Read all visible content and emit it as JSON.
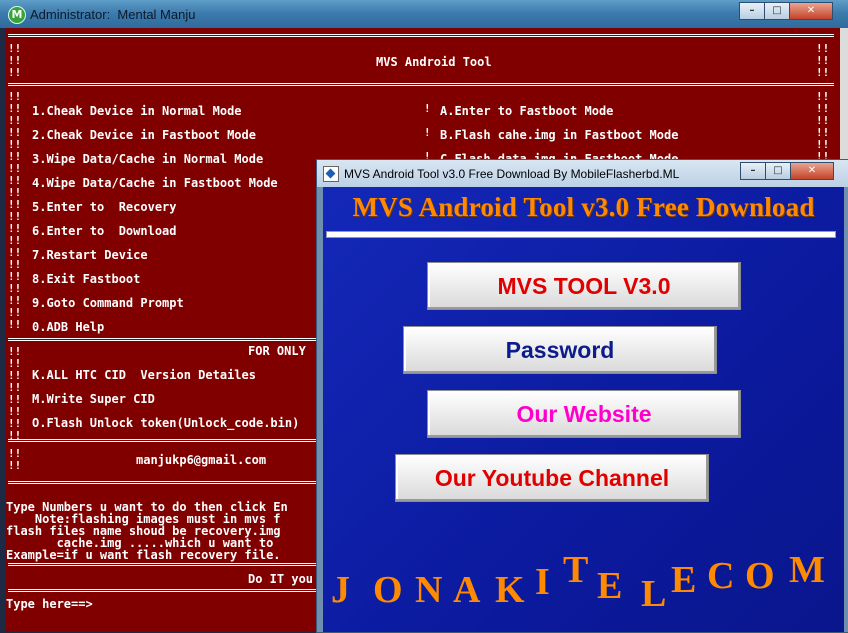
{
  "console": {
    "title": "Administrator:  Mental Manju",
    "app_initial": "M",
    "minimize": "–",
    "maximize": "□",
    "close": "✕",
    "heading": "MVS Android Tool",
    "left_menu": [
      "1.Cheak Device in Normal Mode",
      "2.Cheak Device in Fastboot Mode",
      "3.Wipe Data/Cache in Normal Mode",
      "4.Wipe Data/Cache in Fastboot Mode",
      "5.Enter to  Recovery",
      "6.Enter to  Download",
      "7.Restart Device",
      "8.Exit Fastboot",
      "9.Goto Command Prompt",
      "0.ADB Help"
    ],
    "right_menu": [
      "A.Enter to Fastboot Mode",
      "B.Flash cahe.img in Fastboot Mode",
      "C.Flash data.img in Fastboot Mode"
    ],
    "for_only": "FOR ONLY",
    "htc_menu": [
      "K.ALL HTC CID  Version Detailes",
      "M.Write Super CID",
      "O.Flash Unlock token(Unlock_code.bin)"
    ],
    "email": "manjukp6@gmail.com",
    "notes": [
      "Type Numbers u want to do then click En",
      "    Note:flashing images must in mvs f",
      "flash files name shoud be recovery.img",
      "       cache.img .....which u want to",
      "Example=if u want flash recovery file."
    ],
    "do_it": "Do IT you",
    "prompt": "Type here==>"
  },
  "mvs": {
    "title": "MVS Android Tool v3.0 Free Download By MobileFlasherbd.ML",
    "minimize": "–",
    "maximize": "□",
    "close": "✕",
    "heading": "MVS Android Tool v3.0 Free Download",
    "buttons": {
      "tool": "MVS TOOL V3.0",
      "password": "Password",
      "website": "Our Website",
      "youtube": "Our Youtube Channel"
    },
    "brand_letters": [
      "J",
      "O",
      "N",
      "A",
      "K",
      "I",
      "T",
      "E",
      "L",
      "E",
      "C",
      "O",
      "M"
    ],
    "colors": {
      "tool": "#e00000",
      "password": "#0c1c8c",
      "website": "#ff00cc",
      "youtube": "#e00000",
      "accent": "#ff8a00"
    }
  }
}
